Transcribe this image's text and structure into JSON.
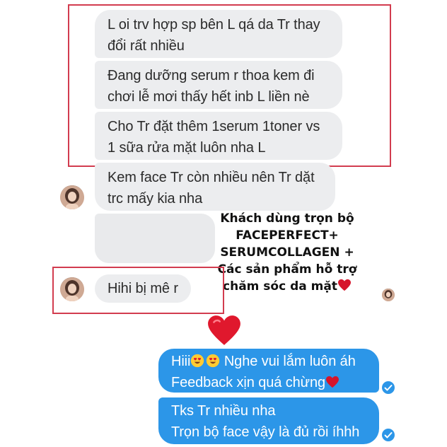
{
  "incoming": [
    {
      "text": "L oi trv hợp sp bên L qá da Tr thay\nđổi rất nhiều"
    },
    {
      "text": "Đang dưỡng serum r thoa kem đi\nchơi lễ mơi thấy hết inb L liền nè"
    },
    {
      "text": "Cho Tr đặt thêm 1serum 1toner vs\n1 sữa rửa mặt luôn nha L"
    },
    {
      "text": "Kem face Tr còn nhiều nên Tr dặt\ntrc mấy kia nha"
    },
    {
      "text": "Hihi bị mê r"
    }
  ],
  "caption": {
    "text": "Khách dùng trọn bộ\nFACEPERFECT+\nSERUMCOLLAGEN +\nCác sản phẩm hỗ trợ\nchăm sóc da mặt",
    "heart_icon": "red-heart-icon"
  },
  "outgoing": [
    {
      "prefix": "Hiii",
      "middle": " Nghe vui lắm luôn áh",
      "line2": "Feedback xịn quá chừng",
      "emoji": "heart-eyes-emoji",
      "heart": "red-heart-icon"
    },
    {
      "text": "Tks Tr nhiều nha\nTrọn bộ face vậy là đủ rồi íhhh"
    }
  ],
  "colors": {
    "incoming_bubble": "#ecedef",
    "outgoing_bubble": "#2c96e8",
    "highlight_box": "#d23c4f",
    "heart": "#d6152b"
  }
}
